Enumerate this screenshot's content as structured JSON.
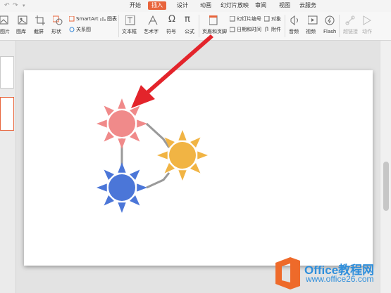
{
  "menu": {
    "tabs": [
      {
        "label": "开始"
      },
      {
        "label": "插入"
      },
      {
        "label": "设计"
      },
      {
        "label": "动画"
      },
      {
        "label": "幻灯片放映"
      },
      {
        "label": "审阅"
      },
      {
        "label": "视图"
      },
      {
        "label": "云服务"
      }
    ],
    "active_tab": "插入"
  },
  "ribbon": {
    "picture": "图片",
    "gallery": "图库",
    "screenshot": "截屏",
    "shape": "形状",
    "smartart": "SmartArt",
    "chart": "图表",
    "relation": "关系图",
    "textbox": "文本框",
    "wordart": "艺术字",
    "symbol": "符号",
    "formula": "公式",
    "header_footer": "页眉和页脚",
    "slide_number": "幻灯片编号",
    "object": "对象",
    "datetime": "日期和时间",
    "attachment": "附件",
    "audio": "音频",
    "video": "视频",
    "flash": "Flash",
    "hyperlink": "超链接",
    "action": "动作"
  },
  "diagram": {
    "nodes": [
      {
        "color": "#f08a8a"
      },
      {
        "color": "#f1b444"
      },
      {
        "color": "#4b76d8"
      }
    ],
    "connector_color": "#9a9a9a"
  },
  "arrow_color": "#e3242b",
  "watermark": {
    "title": "Office教程网",
    "url": "www.office26.com",
    "logo_color": "#ee6a2a"
  }
}
